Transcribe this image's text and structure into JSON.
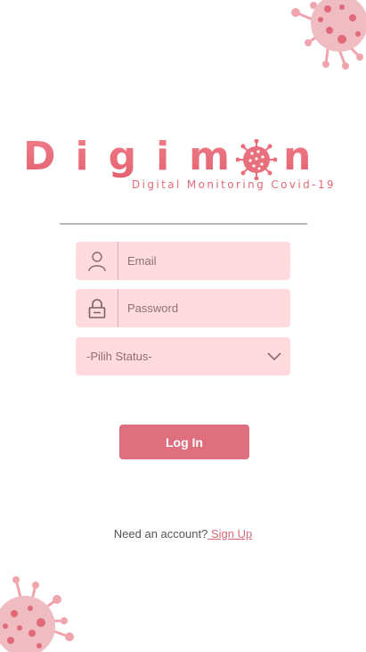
{
  "brand": {
    "word_start": "Digim",
    "word_end": "n",
    "tagline": "Digital Monitoring Covid-19",
    "color": "#e8707d"
  },
  "form": {
    "email_placeholder": "Email",
    "password_placeholder": "Password",
    "status_placeholder": "-Pilih Status-",
    "field_bg": "#ffdadf"
  },
  "actions": {
    "login_label": "Log In",
    "login_color": "#dd6f7f"
  },
  "footer": {
    "prompt": "Need an account?",
    "signup_label": " Sign Up"
  },
  "icons": {
    "email": "person-icon",
    "password": "lock-icon",
    "status": "chevron-down-icon"
  }
}
